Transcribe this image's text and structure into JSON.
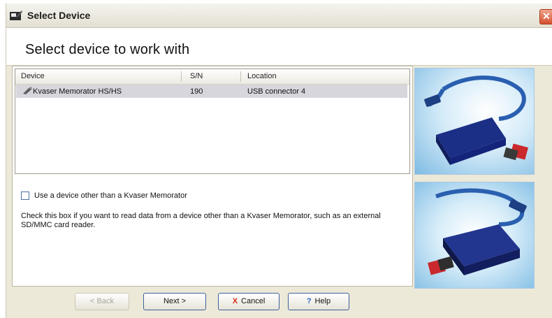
{
  "window": {
    "title": "Select Device",
    "close_glyph": "✕"
  },
  "header": {
    "title": "Select device to work with"
  },
  "device_list": {
    "columns": [
      "Device",
      "S/N",
      "Location"
    ],
    "rows": [
      {
        "device": "Kvaser Memorator HS/HS",
        "sn": "190",
        "location": "USB connector 4",
        "icon": "device-icon",
        "selected": true
      }
    ]
  },
  "options": {
    "other_device_label": "Use a device other than a Kvaser Memorator",
    "other_device_checked": false,
    "help_text": "Check this box if you want to read data from a device other than a Kvaser Memorator, such as an external SD/MMC card reader."
  },
  "buttons": {
    "back": "< Back",
    "next": "Next >",
    "cancel": "Cancel",
    "cancel_icon": "X",
    "help": "Help",
    "help_icon": "?"
  },
  "colors": {
    "cancel_icon": "#d4291a",
    "help_icon": "#2f62c9",
    "selection": "#d6d6dc"
  }
}
